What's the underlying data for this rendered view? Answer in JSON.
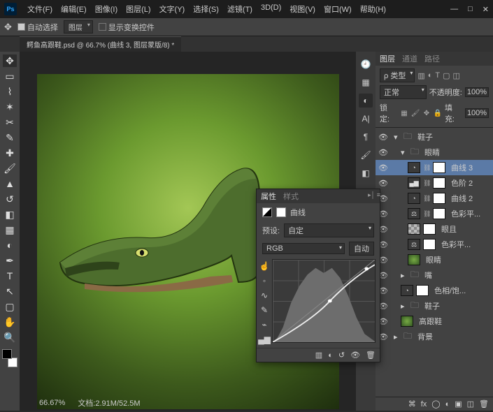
{
  "menus": [
    "文件(F)",
    "编辑(E)",
    "图像(I)",
    "图层(L)",
    "文字(Y)",
    "选择(S)",
    "滤镜(T)",
    "3D(D)",
    "视图(V)",
    "窗口(W)",
    "帮助(H)"
  ],
  "optbar": {
    "auto_select": "自动选择",
    "auto_select_target": "图层",
    "show_transform": "显示变换控件"
  },
  "doc_tab": "鳄鱼高跟鞋.psd @ 66.7% (曲线 3, 图层蒙版/8) *",
  "props": {
    "tab1": "属性",
    "tab2": "样式",
    "adj_name": "曲线",
    "preset_label": "预设:",
    "preset_value": "自定",
    "channel": "RGB",
    "auto": "自动"
  },
  "layers_panel": {
    "tabs": [
      "图层",
      "通道",
      "路径"
    ],
    "kind_label": "ρ 类型",
    "blend": "正常",
    "opacity_label": "不透明度:",
    "opacity": "100%",
    "lock_label": "锁定:",
    "fill_label": "填充:",
    "fill": "100%"
  },
  "layers": [
    {
      "depth": 0,
      "type": "group",
      "open": true,
      "name": "鞋子"
    },
    {
      "depth": 1,
      "type": "group",
      "open": true,
      "name": "眼睛"
    },
    {
      "depth": 2,
      "type": "adj",
      "name": "曲线 3",
      "sel": true,
      "mask": "w",
      "link": true
    },
    {
      "depth": 2,
      "type": "adj",
      "name": "色阶 2",
      "mask": "w",
      "link": true,
      "micon": "hist"
    },
    {
      "depth": 2,
      "type": "adj",
      "name": "曲线 2",
      "mask": "w",
      "link": true
    },
    {
      "depth": 2,
      "type": "adj",
      "name": "色彩平...",
      "mask": "w",
      "link": true,
      "micon": "bal"
    },
    {
      "depth": 2,
      "type": "layer",
      "name": "眼且",
      "thumb": "tr",
      "mask": "w"
    },
    {
      "depth": 2,
      "type": "adj",
      "name": "色彩平...",
      "mask": "w",
      "micon": "bal"
    },
    {
      "depth": 2,
      "type": "layer",
      "name": "眼睛",
      "thumb": "g"
    },
    {
      "depth": 1,
      "type": "group",
      "open": false,
      "name": "嘴"
    },
    {
      "depth": 1,
      "type": "adj",
      "name": "色相/饱...",
      "mask": "w"
    },
    {
      "depth": 1,
      "type": "group",
      "open": false,
      "name": "鞋子"
    },
    {
      "depth": 1,
      "type": "layer",
      "name": "高跟鞋",
      "thumb": "g"
    },
    {
      "depth": 0,
      "type": "group",
      "open": false,
      "name": "背景"
    }
  ],
  "status": {
    "zoom": "66.67%",
    "docsize": "文档:2.91M/52.5M"
  }
}
